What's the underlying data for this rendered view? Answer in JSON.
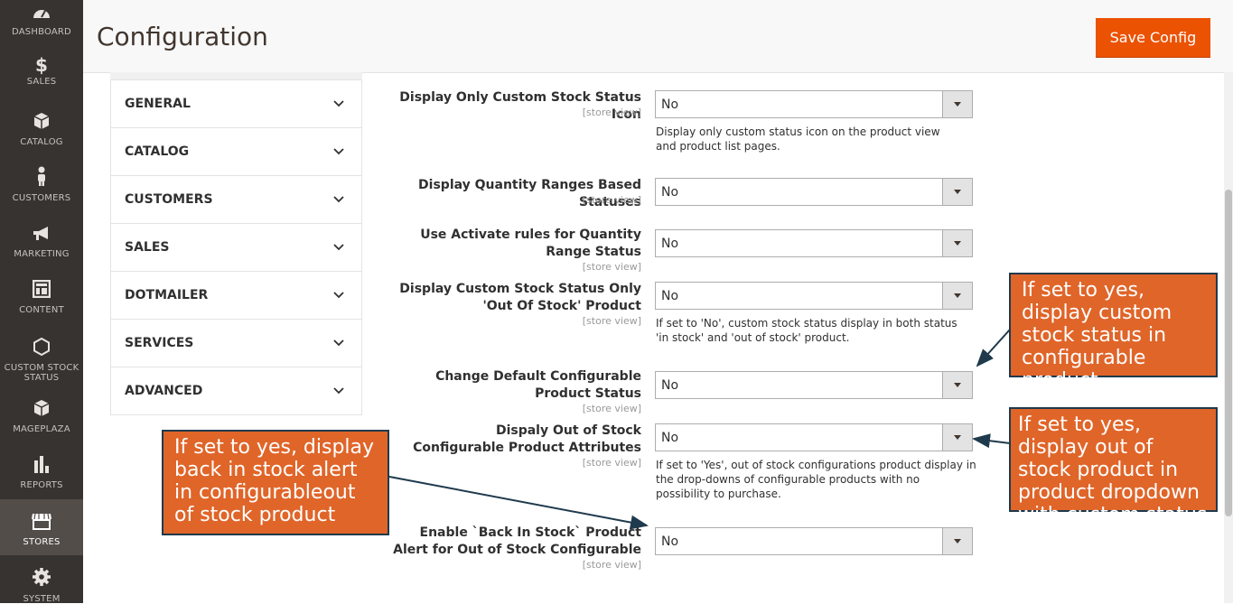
{
  "nav": {
    "items": [
      {
        "label": "DASHBOARD",
        "icon": "dashboard-icon"
      },
      {
        "label": "SALES",
        "icon": "dollar-icon"
      },
      {
        "label": "CATALOG",
        "icon": "box-icon"
      },
      {
        "label": "CUSTOMERS",
        "icon": "person-icon"
      },
      {
        "label": "MARKETING",
        "icon": "megaphone-icon"
      },
      {
        "label": "CONTENT",
        "icon": "layout-icon"
      },
      {
        "label": "CUSTOM STOCK STATUS",
        "icon": "hexagon-icon"
      },
      {
        "label": "MAGEPLAZA",
        "icon": "cube-icon"
      },
      {
        "label": "REPORTS",
        "icon": "bar-chart-icon"
      },
      {
        "label": "STORES",
        "icon": "store-icon"
      },
      {
        "label": "SYSTEM",
        "icon": "gear-icon"
      }
    ]
  },
  "header": {
    "title": "Configuration",
    "save_label": "Save Config"
  },
  "tabs": [
    "GENERAL",
    "CATALOG",
    "CUSTOMERS",
    "SALES",
    "DOTMAILER",
    "SERVICES",
    "ADVANCED"
  ],
  "fields": [
    {
      "label": "Display Only Custom Stock Status Icon",
      "scope": "[store view]",
      "value": "No",
      "note": "Display only custom status icon on the product view and product list pages."
    },
    {
      "label": "Display Quantity Ranges Based Statuses",
      "scope": "[store view]",
      "value": "No"
    },
    {
      "label": "Use Activate rules for Quantity Range Status",
      "scope": "[store view]",
      "value": "No"
    },
    {
      "label": "Display Custom Stock Status Only 'Out Of Stock' Product",
      "scope": "[store view]",
      "value": "No",
      "note": "If set to 'No', custom stock status display in both status 'in stock' and 'out of stock' product."
    },
    {
      "label": "Change Default Configurable Product Status",
      "scope": "[store view]",
      "value": "No"
    },
    {
      "label": "Dispaly Out of Stock Configurable Product Attributes",
      "scope": "[store view]",
      "value": "No",
      "note": "If set to 'Yes', out of stock configurations product display in the drop-downs of configurable products with no possibility to purchase."
    },
    {
      "label": "Enable `Back In Stock` Product Alert for Out of Stock Configurable",
      "scope": "[store view]",
      "value": "No"
    }
  ],
  "callouts": {
    "configurable": "If set to yes, display custom stock status in configurable product",
    "dropdown": "If set to yes, display out of stock product in product dropdown with custom status",
    "back_in_stock": "If set to yes, display back in stock alert in configurableout of stock product"
  },
  "colors": {
    "accent": "#eb5202",
    "nav_bg": "#373330",
    "callout_bg": "#e06529",
    "callout_border": "#1f3a4d"
  }
}
